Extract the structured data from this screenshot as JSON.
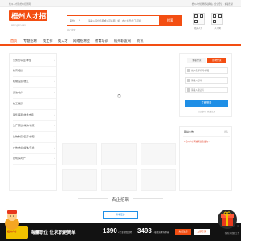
{
  "topbar": {
    "left_text": "梧州人才网(梧州招聘网)",
    "right_text": "梧州人才招聘移动网站 · 企业登录 · 求职登录"
  },
  "header": {
    "logo_text": "梧州人才招聘网",
    "domain_text": "wzrc.gxrc.com",
    "search": {
      "scope": "职位",
      "placeholder": "请输入职位名称或公司名称，如：办公文员/普工/司机",
      "button": "搜索"
    },
    "hot_text": "热门搜索：",
    "qr": [
      {
        "label": "梧州人才"
      },
      {
        "label": "人才网"
      }
    ]
  },
  "nav": {
    "items": [
      {
        "label": "首页",
        "active": true
      },
      {
        "label": "专题招聘"
      },
      {
        "label": "找工作"
      },
      {
        "label": "找人才"
      },
      {
        "label": "网络招聘会"
      },
      {
        "label": "教育培训"
      },
      {
        "label": "梧州职友网"
      },
      {
        "label": "资讯"
      }
    ]
  },
  "categories": [
    "公务员/事业/单位",
    "教育/培训",
    "机械/设备/技工",
    "通信/电子",
    "化工/能源",
    "销售/客服/技术支持",
    "生产/营运/采购/物流",
    "生物/制药/医疗/护理",
    "广告/市场/媒体/艺术",
    "建筑/房地产"
  ],
  "login": {
    "tab_personal": "求职登录",
    "tab_company": "招聘登录",
    "username_placeholder": "用户名/手机号/邮箱",
    "password_placeholder": "请输入密码",
    "code_placeholder": "请输入验证码",
    "button": "立即登录",
    "links": "忘记密码 · 免费注册"
  },
  "notice": {
    "title": "网站公告",
    "more": "更多",
    "item": "• 梧州人才网诚聘信息发布..."
  },
  "section": {
    "title": "名企招聘",
    "more_button": "查看更多"
  },
  "footer": {
    "badge": "梧州人才",
    "slogan": "海量职位 让求职更简单",
    "stat1_num": "1390",
    "stat1_text": "+企业在线招聘",
    "stat2_num": "3493",
    "stat2_text": "+ 职位需求等你来",
    "btn_register": "免费注册",
    "btn_login": "立即登录",
    "close": "×"
  },
  "gift_label": "手机扫码领取工作"
}
